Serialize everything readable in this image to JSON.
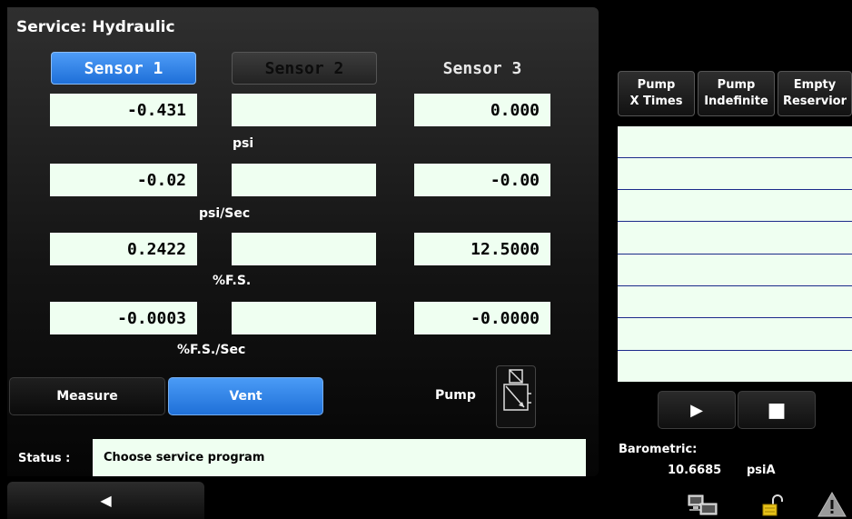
{
  "header": {
    "title": "Service: Hydraulic"
  },
  "sensors": {
    "tabs": [
      "Sensor 1",
      "Sensor 2",
      "Sensor 3"
    ]
  },
  "readings": [
    {
      "unit": "psi",
      "sensor1": "-0.431",
      "sensor2": "",
      "sensor3": "0.000"
    },
    {
      "unit": "psi/Sec",
      "sensor1": "-0.02",
      "sensor2": "",
      "sensor3": "-0.00"
    },
    {
      "unit": "%F.S.",
      "sensor1": "0.2422",
      "sensor2": "",
      "sensor3": "12.5000"
    },
    {
      "unit": "%F.S./Sec",
      "sensor1": "-0.0003",
      "sensor2": "",
      "sensor3": "-0.0000"
    }
  ],
  "modes": {
    "measure": "Measure",
    "vent": "Vent"
  },
  "pump": {
    "label": "Pump"
  },
  "status": {
    "label": "Status :",
    "text": "Choose service program"
  },
  "nav": {
    "back_glyph": "◀"
  },
  "right_buttons": [
    {
      "line1": "Pump",
      "line2": "X Times"
    },
    {
      "line1": "Pump",
      "line2": "Indefinite"
    },
    {
      "line1": "Empty",
      "line2": "Reservior"
    }
  ],
  "controls": {
    "play_glyph": "▶",
    "stop_glyph": "■"
  },
  "barometric": {
    "label": "Barometric:",
    "value": "10.6685",
    "unit": "psiA"
  },
  "icons": [
    "network-icon",
    "lock-icon",
    "warning-icon"
  ],
  "colors": {
    "accent": "#1e6fd8",
    "field_bg": "#effff1",
    "list_line": "#1b2a8a"
  }
}
